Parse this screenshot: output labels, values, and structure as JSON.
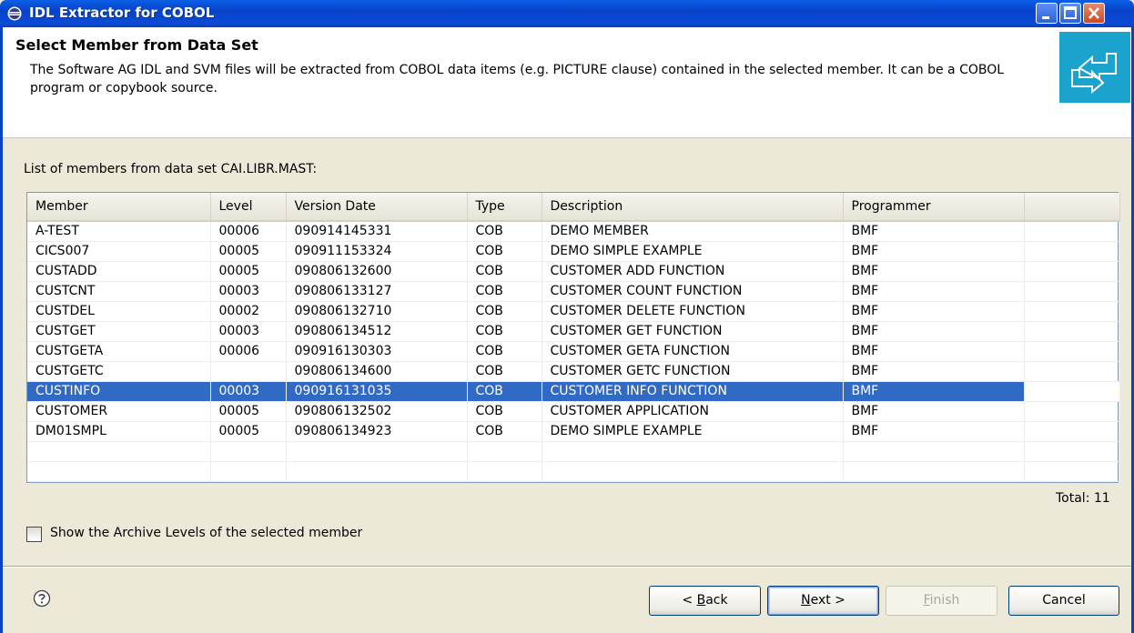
{
  "window": {
    "title": "IDL Extractor for COBOL"
  },
  "header": {
    "title": "Select Member from Data Set",
    "description": "The Software AG IDL and SVM files will be extracted from COBOL data items (e.g. PICTURE clause) contained in the selected member. It can be a COBOL program or copybook source."
  },
  "list": {
    "label": "List of members from data set CAI.LIBR.MAST:",
    "columns": [
      "Member",
      "Level",
      "Version Date",
      "Type",
      "Description",
      "Programmer"
    ],
    "rows": [
      [
        "A-TEST",
        "00006",
        "090914145331",
        "COB",
        "DEMO MEMBER",
        "BMF"
      ],
      [
        "CICS007",
        "00005",
        "090911153324",
        "COB",
        "DEMO SIMPLE EXAMPLE",
        "BMF"
      ],
      [
        "CUSTADD",
        "00005",
        "090806132600",
        "COB",
        "CUSTOMER ADD FUNCTION",
        "BMF"
      ],
      [
        "CUSTCNT",
        "00003",
        "090806133127",
        "COB",
        "CUSTOMER COUNT FUNCTION",
        "BMF"
      ],
      [
        "CUSTDEL",
        "00002",
        "090806132710",
        "COB",
        "CUSTOMER DELETE FUNCTION",
        "BMF"
      ],
      [
        "CUSTGET",
        "00003",
        "090806134512",
        "COB",
        "CUSTOMER GET FUNCTION",
        "BMF"
      ],
      [
        "CUSTGETA",
        "00006",
        "090916130303",
        "COB",
        "CUSTOMER GETA FUNCTION",
        "BMF"
      ],
      [
        "CUSTGETC",
        "",
        "090806134600",
        "COB",
        "CUSTOMER GETC FUNCTION",
        "BMF"
      ],
      [
        "CUSTINFO",
        "00003",
        "090916131035",
        "COB",
        "CUSTOMER INFO FUNCTION",
        "BMF"
      ],
      [
        "CUSTOMER",
        "00005",
        "090806132502",
        "COB",
        "CUSTOMER APPLICATION",
        "BMF"
      ],
      [
        "DM01SMPL",
        "00005",
        "090806134923",
        "COB",
        "DEMO SIMPLE EXAMPLE",
        "BMF"
      ]
    ],
    "selected_row": 8,
    "total": "Total: 11"
  },
  "options": {
    "archive_levels_label": "Show the Archive Levels of the selected member",
    "archive_levels_checked": false
  },
  "buttons": {
    "back_prefix": "< ",
    "back_mnemonic": "B",
    "back_rest": "ack",
    "next_mnemonic": "N",
    "next_rest": "ext >",
    "finish_mnemonic": "F",
    "finish_rest": "inish",
    "cancel": "Cancel"
  },
  "colors": {
    "selection": "#316AC5",
    "banner": "#1AA3CC",
    "titlebar": "#0842C8"
  },
  "icons": {
    "app": "eclipse-icon",
    "banner": "extract-arrows-icon",
    "help": "help-icon"
  }
}
